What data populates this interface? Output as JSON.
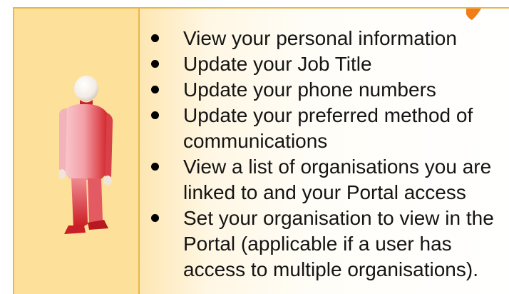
{
  "bullets": [
    {
      "lines": [
        "View your personal information"
      ]
    },
    {
      "lines": [
        "Update your Job Title"
      ]
    },
    {
      "lines": [
        "Update your phone numbers"
      ]
    },
    {
      "lines": [
        "Update your preferred method of",
        "communications"
      ]
    },
    {
      "lines": [
        "View a list of organisations you are",
        "linked to and your Portal access"
      ]
    },
    {
      "lines": [
        "Set your organisation to view in the",
        "Portal (applicable if a user has",
        "access to multiple organisations)."
      ]
    }
  ],
  "colors": {
    "panel_yellow": "#fde099",
    "panel_border": "#e7b84a",
    "figure_red": "#d4272c",
    "accent_orange": "#f07d18"
  },
  "icons": {
    "figure": "person-figure-icon",
    "bullet": "bullet-dot-icon"
  }
}
